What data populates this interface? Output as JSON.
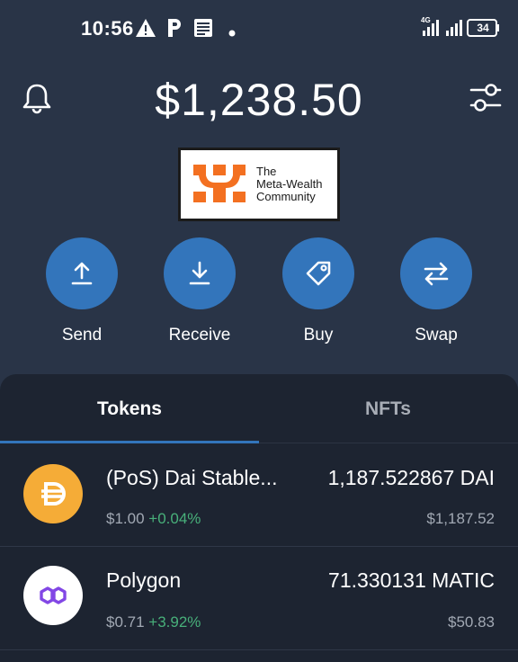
{
  "status_bar": {
    "time": "10:56",
    "battery": "34",
    "network": "4G",
    "icons": [
      "warning-icon",
      "parking-icon",
      "news-icon",
      "dot-icon"
    ]
  },
  "header": {
    "balance": "$1,238.50",
    "left_icon": "bell-icon",
    "right_icon": "filter-sliders-icon"
  },
  "logo": {
    "line1": "The",
    "line2": "Meta-Wealth",
    "line3": "Community"
  },
  "actions": [
    {
      "label": "Send",
      "icon": "arrow-up-icon"
    },
    {
      "label": "Receive",
      "icon": "arrow-down-icon"
    },
    {
      "label": "Buy",
      "icon": "tag-icon"
    },
    {
      "label": "Swap",
      "icon": "swap-arrows-icon"
    }
  ],
  "tabs": {
    "tokens": "Tokens",
    "nfts": "NFTs",
    "active": "tokens"
  },
  "tokens": [
    {
      "name": "(PoS) Dai Stable...",
      "price": "$1.00",
      "change": "+0.04%",
      "amount": "1,187.522867 DAI",
      "value": "$1,187.52",
      "icon": "dai-icon",
      "color": "#f5ac37"
    },
    {
      "name": "Polygon",
      "price": "$0.71",
      "change": "+3.92%",
      "amount": "71.330131 MATIC",
      "value": "$50.83",
      "icon": "polygon-icon",
      "color": "#8247e5"
    }
  ],
  "colors": {
    "background": "#293447",
    "panel": "#1d2431",
    "accent": "#3375bb",
    "positive": "#48b07a"
  }
}
